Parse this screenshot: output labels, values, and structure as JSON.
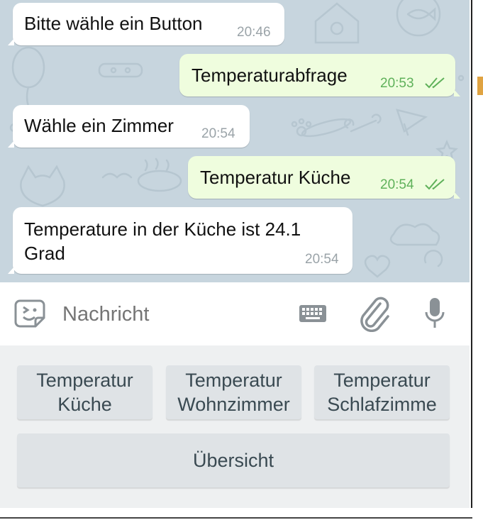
{
  "messages": [
    {
      "direction": "in",
      "lines": [
        "Bitte wähle ein Button"
      ],
      "time": "20:46"
    },
    {
      "direction": "out",
      "lines": [
        "Temperaturabfrage"
      ],
      "time": "20:53",
      "status": "read"
    },
    {
      "direction": "in",
      "lines": [
        "Wähle ein Zimmer"
      ],
      "time": "20:54"
    },
    {
      "direction": "out",
      "lines": [
        "Temperatur Küche"
      ],
      "time": "20:54",
      "status": "read"
    },
    {
      "direction": "in",
      "lines": [
        "Temperature in der Küche ist 24.1",
        "Grad"
      ],
      "time": "20:54"
    }
  ],
  "input": {
    "placeholder": "Nachricht",
    "icons": [
      "sticker-icon",
      "keyboard-icon",
      "paperclip-icon",
      "microphone-icon"
    ]
  },
  "keyboard": {
    "row1": [
      {
        "lines": [
          "Temperatur",
          "Küche"
        ]
      },
      {
        "lines": [
          "Temperatur",
          "Wohnzimmer"
        ]
      },
      {
        "lines": [
          "Temperatur",
          "Schlafzimme"
        ]
      }
    ],
    "row2": [
      {
        "lines": [
          "Übersicht"
        ]
      }
    ]
  },
  "colors": {
    "chat_bg": "#c7d5de",
    "incoming_bubble": "#ffffff",
    "outgoing_bubble": "#effdde",
    "outgoing_time": "#5fb15a",
    "keyboard_bg": "#eef0f1",
    "key_bg": "#dfe3e6"
  }
}
